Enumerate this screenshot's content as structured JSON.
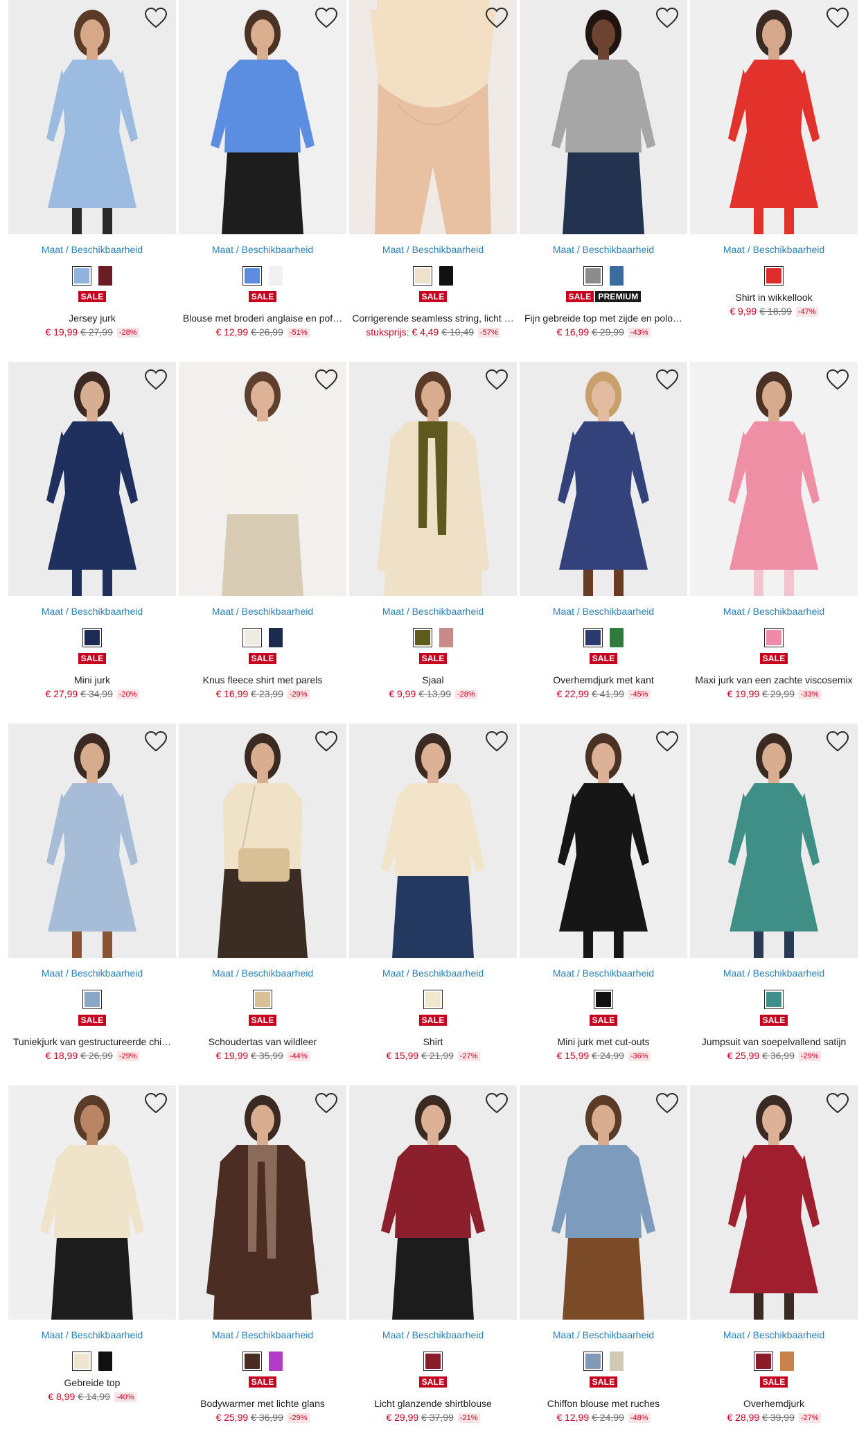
{
  "products": [
    {
      "size_link": "Maat / Beschikbaarheid",
      "name": "Jersey jurk",
      "price": "€ 19,99",
      "was": "€ 27,99",
      "discount": "-28%",
      "unit_label": "",
      "badges": [
        "SALE"
      ],
      "swatches": [
        "#8fb3dc",
        "#6a1d25"
      ],
      "colors": {
        "bg": "#ececec",
        "garment": "#9cbbe0",
        "skin": "#d7a887",
        "hair": "#5a3b28",
        "accent": "#2a2a2a"
      },
      "figure": "dress"
    },
    {
      "size_link": "Maat / Beschikbaarheid",
      "name": "Blouse met broderi anglaise en pof…",
      "price": "€ 12,99",
      "was": "€ 26,99",
      "discount": "-51%",
      "unit_label": "",
      "badges": [
        "SALE"
      ],
      "swatches": [
        "#5a8de0",
        "#f1f1f1"
      ],
      "colors": {
        "bg": "#f0f0f0",
        "garment": "#5b8ee0",
        "skin": "#dcae90",
        "hair": "#4a3224",
        "accent": "#1d1d1d"
      },
      "figure": "top"
    },
    {
      "size_link": "Maat / Beschikbaarheid",
      "name": "Corrigerende seamless string, licht …",
      "price": "€ 4,49",
      "was": "€ 10,49",
      "discount": "-57%",
      "unit_label": "stuksprijs: ",
      "badges": [
        "SALE"
      ],
      "swatches": [
        "#efe2cd",
        "#111111"
      ],
      "colors": {
        "bg": "#efeae6",
        "garment": "#f3dfc4",
        "skin": "#e8c0a2",
        "hair": "#e8c0a2",
        "accent": "#e8c0a2"
      },
      "figure": "brief"
    },
    {
      "size_link": "Maat / Beschikbaarheid",
      "name": "Fijn gebreide top met zijde en polo…",
      "price": "€ 16,99",
      "was": "€ 29,99",
      "discount": "-43%",
      "unit_label": "",
      "badges": [
        "SALE",
        "PREMIUM"
      ],
      "swatches": [
        "#8c8c8c",
        "#3b6c9e"
      ],
      "colors": {
        "bg": "#ececec",
        "garment": "#a6a6a6",
        "skin": "#6b4330",
        "hair": "#1f1410",
        "accent": "#22324f"
      },
      "figure": "top"
    },
    {
      "size_link": "Maat / Beschikbaarheid",
      "name": "Shirt in wikkellook",
      "price": "€ 9,99",
      "was": "€ 18,99",
      "discount": "-47%",
      "unit_label": "",
      "badges": [],
      "swatches": [
        "#e02b2b"
      ],
      "colors": {
        "bg": "#efefef",
        "garment": "#e3312c",
        "skin": "#d6a88b",
        "hair": "#3a2a22",
        "accent": "#e3312c"
      },
      "figure": "dress"
    },
    {
      "size_link": "Maat / Beschikbaarheid",
      "name": "Mini jurk",
      "price": "€ 27,99",
      "was": "€ 34,99",
      "discount": "-20%",
      "unit_label": "",
      "badges": [
        "SALE"
      ],
      "swatches": [
        "#1d2a54"
      ],
      "colors": {
        "bg": "#ececec",
        "garment": "#1f2f5e",
        "skin": "#d8ae92",
        "hair": "#3c2a22",
        "accent": "#1f2f5e"
      },
      "figure": "dress"
    },
    {
      "size_link": "Maat / Beschikbaarheid",
      "name": "Knus fleece shirt met parels",
      "price": "€ 16,99",
      "was": "€ 23,99",
      "discount": "-29%",
      "unit_label": "",
      "badges": [
        "SALE"
      ],
      "swatches": [
        "#eeebe3",
        "#1c2a4e"
      ],
      "colors": {
        "bg": "#f1f0ee",
        "garment": "#f3f1ec",
        "skin": "#dcb396",
        "hair": "#5d402d",
        "accent": "#d8ccb5"
      },
      "figure": "top"
    },
    {
      "size_link": "Maat / Beschikbaarheid",
      "name": "Sjaal",
      "price": "€ 9,99",
      "was": "€ 13,99",
      "discount": "-28%",
      "unit_label": "",
      "badges": [
        "SALE"
      ],
      "swatches": [
        "#5d5a1c",
        "#c98b8a"
      ],
      "colors": {
        "bg": "#ececec",
        "garment": "#eee1c8",
        "skin": "#d9ad90",
        "hair": "#5a3b28",
        "accent": "#5e5a1f"
      },
      "figure": "coat"
    },
    {
      "size_link": "Maat / Beschikbaarheid",
      "name": "Overhemdjurk met kant",
      "price": "€ 22,99",
      "was": "€ 41,99",
      "discount": "-45%",
      "unit_label": "",
      "badges": [
        "SALE"
      ],
      "swatches": [
        "#2b3a6d",
        "#2f7a3c"
      ],
      "colors": {
        "bg": "#ececec",
        "garment": "#33427a",
        "skin": "#e2bca1",
        "hair": "#c8a06c",
        "accent": "#6a3a24"
      },
      "figure": "dress"
    },
    {
      "size_link": "Maat / Beschikbaarheid",
      "name": "Maxi jurk van een zachte viscosemix",
      "price": "€ 19,99",
      "was": "€ 29,99",
      "discount": "-33%",
      "unit_label": "",
      "badges": [
        "SALE"
      ],
      "swatches": [
        "#f08aa8"
      ],
      "colors": {
        "bg": "#f2f2f2",
        "garment": "#ef8fa6",
        "skin": "#d7ab8d",
        "hair": "#4b3224",
        "accent": "#f3c3cf"
      },
      "figure": "dress"
    },
    {
      "size_link": "Maat / Beschikbaarheid",
      "name": "Tuniekjurk van gestructureerde chi…",
      "price": "€ 18,99",
      "was": "€ 26,99",
      "discount": "-29%",
      "unit_label": "",
      "badges": [
        "SALE"
      ],
      "swatches": [
        "#8aa6c6"
      ],
      "colors": {
        "bg": "#ececec",
        "garment": "#a7bcd6",
        "skin": "#d7ab8d",
        "hair": "#3b2a22",
        "accent": "#8a5332"
      },
      "figure": "dress"
    },
    {
      "size_link": "Maat / Beschikbaarheid",
      "name": "Schoudertas van wildleer",
      "price": "€ 19,99",
      "was": "€ 35,99",
      "discount": "-44%",
      "unit_label": "",
      "badges": [
        "SALE"
      ],
      "swatches": [
        "#d8bf95"
      ],
      "colors": {
        "bg": "#ececec",
        "garment": "#efe2c6",
        "skin": "#d8ad90",
        "hair": "#3a2a22",
        "accent": "#3b2c24"
      },
      "figure": "back"
    },
    {
      "size_link": "Maat / Beschikbaarheid",
      "name": "Shirt",
      "price": "€ 15,99",
      "was": "€ 21,99",
      "discount": "-27%",
      "unit_label": "",
      "badges": [
        "SALE"
      ],
      "swatches": [
        "#f1e7cf"
      ],
      "colors": {
        "bg": "#ececec",
        "garment": "#f1e4c8",
        "skin": "#dcb195",
        "hair": "#3a2a22",
        "accent": "#253860"
      },
      "figure": "top"
    },
    {
      "size_link": "Maat / Beschikbaarheid",
      "name": "Mini jurk met cut-outs",
      "price": "€ 15,99",
      "was": "€ 24,99",
      "discount": "-36%",
      "unit_label": "",
      "badges": [
        "SALE"
      ],
      "swatches": [
        "#111111"
      ],
      "colors": {
        "bg": "#efefef",
        "garment": "#161616",
        "skin": "#dcb195",
        "hair": "#4a3224",
        "accent": "#161616"
      },
      "figure": "dress"
    },
    {
      "size_link": "Maat / Beschikbaarheid",
      "name": "Jumpsuit van soepelvallend satijn",
      "price": "€ 25,99",
      "was": "€ 36,99",
      "discount": "-29%",
      "unit_label": "",
      "badges": [
        "SALE"
      ],
      "swatches": [
        "#3f8f8a"
      ],
      "colors": {
        "bg": "#ececec",
        "garment": "#3f8f86",
        "skin": "#d8ad90",
        "hair": "#3a2a22",
        "accent": "#293a56"
      },
      "figure": "dress"
    },
    {
      "size_link": "Maat / Beschikbaarheid",
      "name": "Gebreide top",
      "price": "€ 8,99",
      "was": "€ 14,99",
      "discount": "-40%",
      "unit_label": "",
      "badges": [],
      "swatches": [
        "#efe4cc",
        "#111111"
      ],
      "colors": {
        "bg": "#efefef",
        "garment": "#efe3c9",
        "skin": "#b98563",
        "hair": "#5a3b28",
        "accent": "#1d1d1d"
      },
      "figure": "top"
    },
    {
      "size_link": "Maat / Beschikbaarheid",
      "name": "Bodywarmer met lichte glans",
      "price": "€ 25,99",
      "was": "€ 36,99",
      "discount": "-29%",
      "unit_label": "",
      "badges": [
        "SALE"
      ],
      "swatches": [
        "#4a2c22",
        "#b23cc8"
      ],
      "colors": {
        "bg": "#ececec",
        "garment": "#4b2d23",
        "skin": "#d8ad90",
        "hair": "#3a2a22",
        "accent": "#8a6a5a"
      },
      "figure": "coat"
    },
    {
      "size_link": "Maat / Beschikbaarheid",
      "name": "Licht glanzende shirtblouse",
      "price": "€ 29,99",
      "was": "€ 37,99",
      "discount": "-21%",
      "unit_label": "",
      "badges": [
        "SALE"
      ],
      "swatches": [
        "#8a1c2a"
      ],
      "colors": {
        "bg": "#ececec",
        "garment": "#8b1f2c",
        "skin": "#dcb195",
        "hair": "#3a2a22",
        "accent": "#1c1c1c"
      },
      "figure": "top"
    },
    {
      "size_link": "Maat / Beschikbaarheid",
      "name": "Chiffon blouse met ruches",
      "price": "€ 12,99",
      "was": "€ 24,99",
      "discount": "-48%",
      "unit_label": "",
      "badges": [
        "SALE"
      ],
      "swatches": [
        "#7e9ab8",
        "#d2c8b6"
      ],
      "colors": {
        "bg": "#ececec",
        "garment": "#7c9bbd",
        "skin": "#d8ad90",
        "hair": "#5a3b28",
        "accent": "#7b4a26"
      },
      "figure": "top"
    },
    {
      "size_link": "Maat / Beschikbaarheid",
      "name": "Overhemdjurk",
      "price": "€ 28,99",
      "was": "€ 39,99",
      "discount": "-27%",
      "unit_label": "",
      "badges": [
        "SALE"
      ],
      "swatches": [
        "#8c1d28",
        "#c8824a"
      ],
      "colors": {
        "bg": "#ececec",
        "garment": "#a01f2e",
        "skin": "#dcb195",
        "hair": "#3a2a22",
        "accent": "#3b2a22"
      },
      "figure": "dress"
    }
  ],
  "icons": {
    "favorite": "heart-outline-icon"
  },
  "theme": {
    "sale": "#c6001f",
    "link": "#2a7fb4",
    "premium": "#1a1a1a"
  }
}
